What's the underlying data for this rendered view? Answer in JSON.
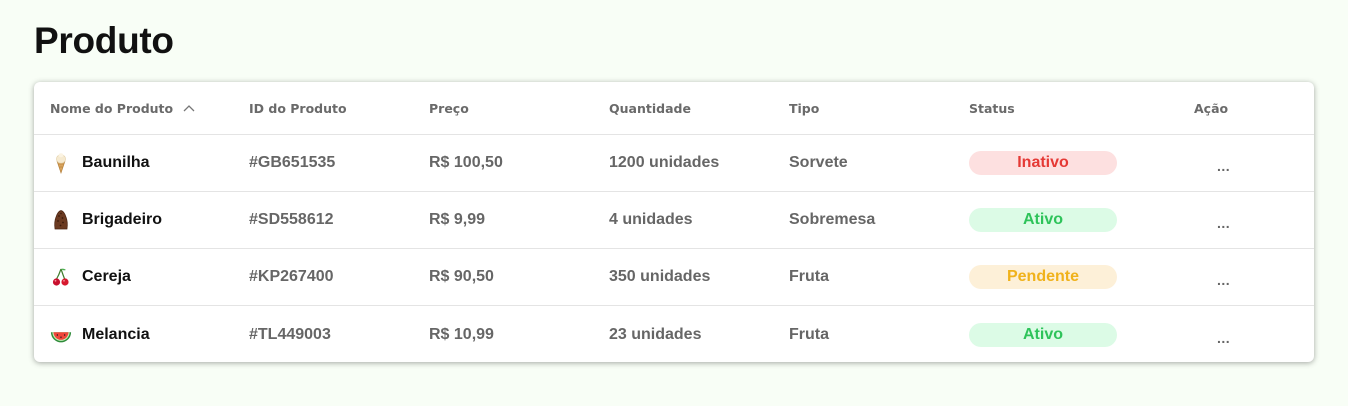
{
  "page": {
    "title": "Produto"
  },
  "table": {
    "columns": {
      "name": "Nome do Produto",
      "id": "ID do Produto",
      "price": "Preço",
      "qty": "Quantidade",
      "type": "Tipo",
      "status": "Status",
      "action": "Ação"
    },
    "sort": {
      "column": "name",
      "direction": "ascending",
      "icon": "chevron-up-icon"
    },
    "rows": [
      {
        "icon": "ice-cream-cone-icon",
        "name": "Baunilha",
        "id": "#GB651535",
        "price": "R$ 100,50",
        "qty": "1200 unidades",
        "type": "Sorvete",
        "status": "Inativo",
        "action": "..."
      },
      {
        "icon": "chocolate-truffle-icon",
        "name": "Brigadeiro",
        "id": "#SD558612",
        "price": "R$ 9,99",
        "qty": "4 unidades",
        "type": "Sobremesa",
        "status": "Ativo",
        "action": "..."
      },
      {
        "icon": "cherries-icon",
        "name": "Cereja",
        "id": "#KP267400",
        "price": "R$ 90,50",
        "qty": "350 unidades",
        "type": "Fruta",
        "status": "Pendente",
        "action": "..."
      },
      {
        "icon": "watermelon-slice-icon",
        "name": "Melancia",
        "id": "#TL449003",
        "price": "R$ 10,99",
        "qty": "23 unidades",
        "type": "Fruta",
        "status": "Ativo",
        "action": "..."
      }
    ]
  },
  "status_colors": {
    "Inativo": {
      "bg": "#fde0e0",
      "fg": "#e53935"
    },
    "Ativo": {
      "bg": "#dcfbe6",
      "fg": "#2ec35a"
    },
    "Pendente": {
      "bg": "#fdf0d8",
      "fg": "#f0b21b"
    }
  },
  "colors": {
    "page_bg": "#f8fef6",
    "card_bg": "#ffffff"
  }
}
